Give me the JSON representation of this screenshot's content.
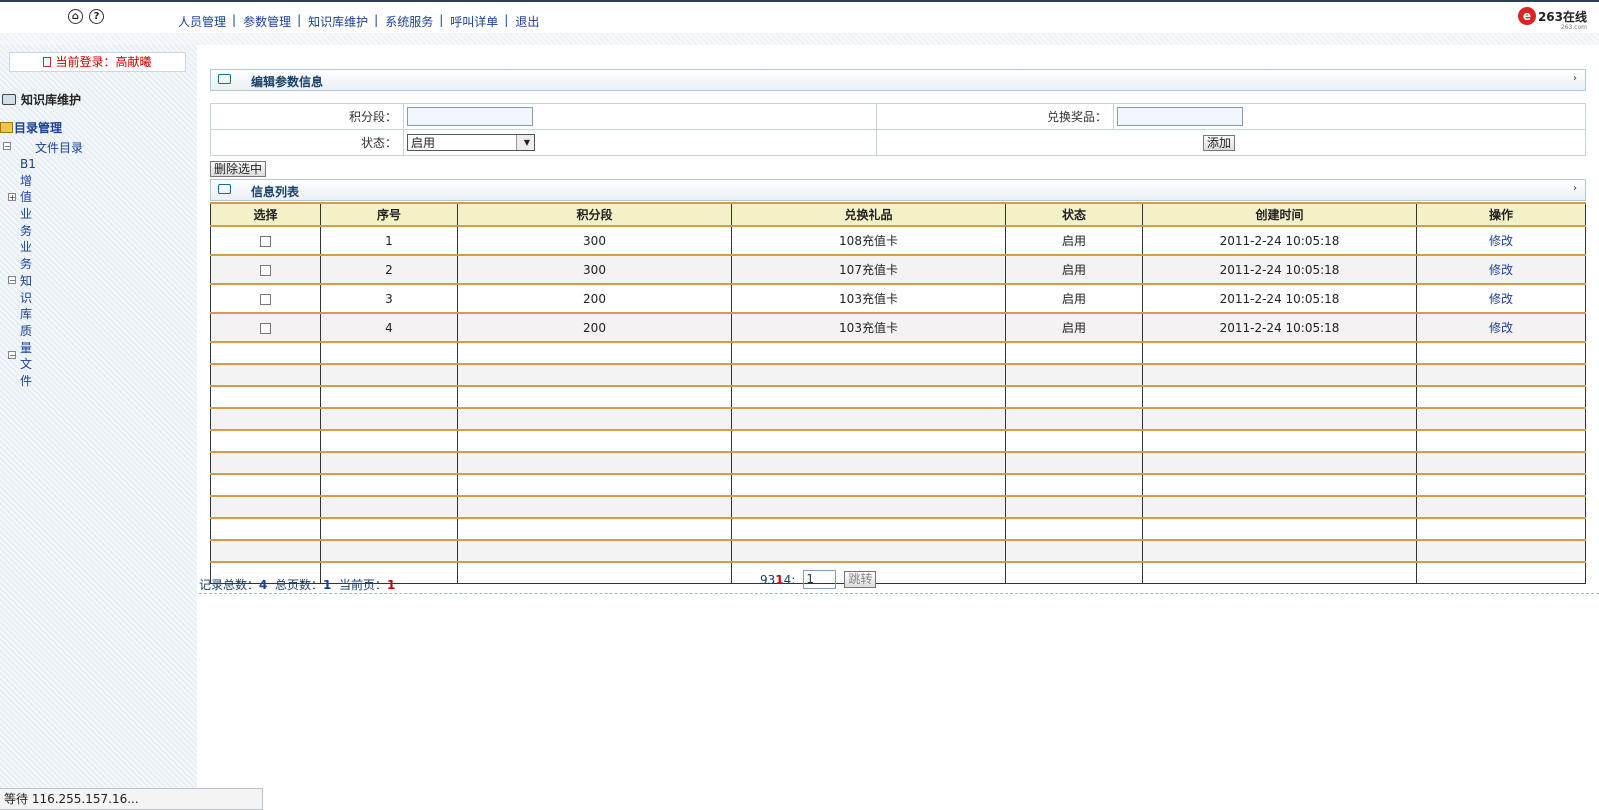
{
  "nav": {
    "items": [
      "人员管理",
      "参数管理",
      "知识库维护",
      "系统服务",
      "呼叫详单",
      "退出"
    ],
    "separator": "|",
    "home_icon_glyph": "⌂",
    "help_icon_glyph": "?"
  },
  "logo": {
    "text": "263在线",
    "sub": "263.com"
  },
  "sidebar": {
    "login_label": "当前登录：高献曦",
    "title": "知识库维护",
    "dir_manage": "目录管理",
    "file_dir": "文件目录",
    "tree_chars": [
      "B1",
      "增",
      "值",
      "业",
      "务",
      "业",
      "务",
      "知",
      "识",
      "库",
      "质",
      "量",
      "文",
      "件"
    ]
  },
  "edit_panel": {
    "title": "编辑参数信息",
    "arrow": "›"
  },
  "form": {
    "points_label": "积分段：",
    "points_value": "",
    "prize_label": "兑换奖品：",
    "prize_value": "",
    "status_label": "状态：",
    "status_selected": "启用",
    "add_button": "添加"
  },
  "delete_button": "删除选中",
  "list_panel": {
    "title": "信息列表",
    "arrow": "›"
  },
  "table": {
    "headers": [
      "选择",
      "序号",
      "积分段",
      "兑换礼品",
      "状态",
      "创建时间",
      "操作"
    ],
    "rows": [
      {
        "seq": "1",
        "points": "300",
        "gift": "108充值卡",
        "status": "启用",
        "created": "2011-2-24 10:05:18",
        "action": "修改"
      },
      {
        "seq": "2",
        "points": "300",
        "gift": "107充值卡",
        "status": "启用",
        "created": "2011-2-24 10:05:18",
        "action": "修改"
      },
      {
        "seq": "3",
        "points": "200",
        "gift": "103充值卡",
        "status": "启用",
        "created": "2011-2-24 10:05:18",
        "action": "修改"
      },
      {
        "seq": "4",
        "points": "200",
        "gift": "103充值卡",
        "status": "启用",
        "created": "2011-2-24 10:05:18",
        "action": "修改"
      }
    ]
  },
  "pager": {
    "total_label": "记录总数：",
    "total": "4",
    "pages_label": "总页数：",
    "pages": "1",
    "current_label": "当前页：",
    "current": "1",
    "page_links_prefix": "93",
    "page_links_current": "1",
    "page_links_suffix": "4:",
    "jump_value": "1",
    "jump_button": "跳转"
  },
  "statusbar": {
    "text": "等待 116.255.157.16..."
  }
}
